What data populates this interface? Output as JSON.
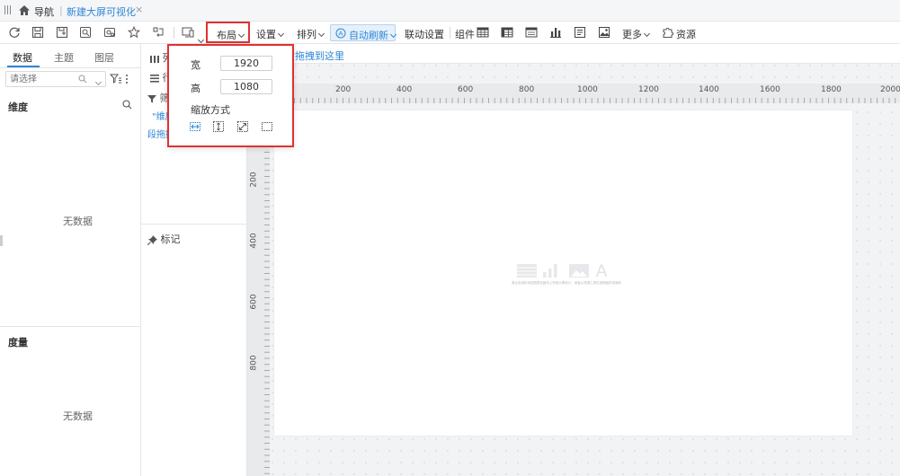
{
  "topbar": {
    "nav_label": "导航",
    "separator": "|",
    "tab_label": "新建大屏可视化",
    "tab_close": "×"
  },
  "toolbar": {
    "layout_label": "布局",
    "settings_label": "设置",
    "arrange_label": "排列",
    "autorefresh_label": "自动刷新",
    "linkage_label": "联动设置",
    "components_label": "组件",
    "more_label": "更多",
    "resources_label": "资源",
    "autorefresh_icon": "A"
  },
  "left_panel": {
    "tabs": [
      "数据",
      "主题",
      "图层"
    ],
    "search_placeholder": "请选择",
    "dimension_title": "维度",
    "measure_title": "度量",
    "no_data": "无数据"
  },
  "mid_panel": {
    "row1_text": "列",
    "row2_text": "行",
    "filter_text": "筛",
    "dim_hint": "\"维度",
    "field_hint": "段拖拽",
    "marks_label": "标记"
  },
  "canvas": {
    "drop_hint": "段拖拽到这里",
    "ruler_top": [
      "200",
      "400",
      "600",
      "800",
      "1000",
      "1200",
      "1400",
      "1600",
      "1800",
      "2000"
    ],
    "ruler_left": [
      "200",
      "400",
      "600",
      "800"
    ],
    "placeholder_letter": "A",
    "placeholder_caption": "请点击组件添加图表至画布上完成大屏设计，或者从资源工具栏拖拽组件到画布"
  },
  "layout_popup": {
    "width_label": "宽",
    "width_value": "1920",
    "height_label": "高",
    "height_value": "1080",
    "scale_label": "缩放方式"
  },
  "colors": {
    "accent": "#2e86d6",
    "highlight_border": "#e03131"
  }
}
